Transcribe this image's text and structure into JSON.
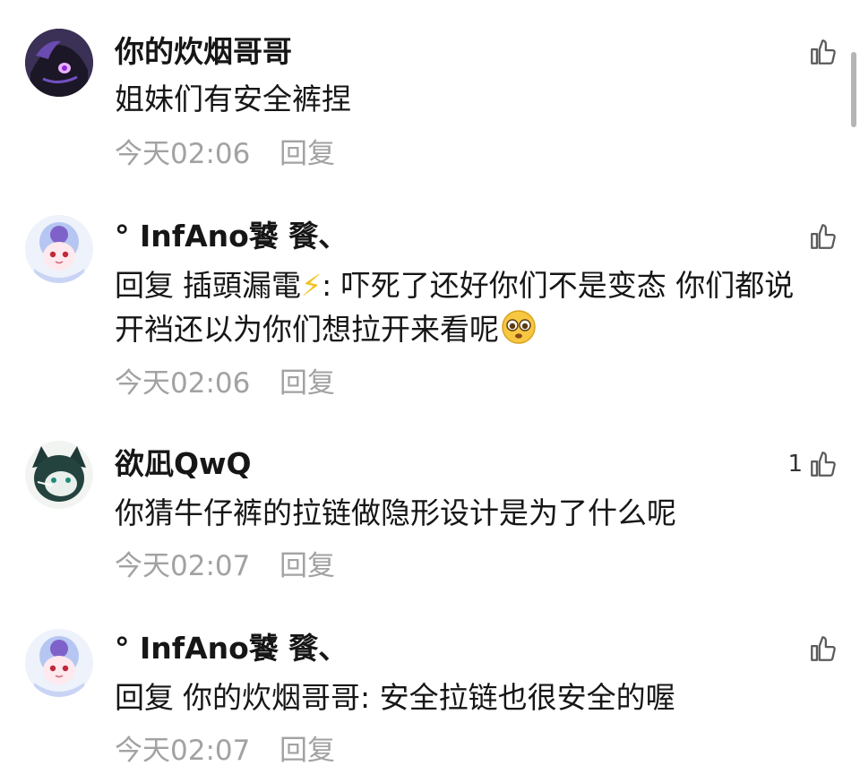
{
  "comments": [
    {
      "author": "你的炊烟哥哥",
      "text": "姐妹们有安全裤捏",
      "time": "今天02:06",
      "reply_label": "回复",
      "likes": ""
    },
    {
      "author": "° InfAno饕 餮、",
      "reply_prefix": "回复",
      "reply_to": "插頭漏電",
      "bolt": "⚡",
      "text": ": 吓死了还好你们不是变态 你们都说开裆还以为你们想拉开来看呢",
      "time": "今天02:06",
      "reply_label": "回复",
      "likes": ""
    },
    {
      "author": "欲凪QwQ",
      "text": "你猜牛仔裤的拉链做隐形设计是为了什么呢",
      "time": "今天02:07",
      "reply_label": "回复",
      "likes": "1"
    },
    {
      "author": "° InfAno饕 餮、",
      "reply_prefix": "回复",
      "reply_to": "你的炊烟哥哥",
      "text": ": 安全拉链也很安全的喔",
      "time": "今天02:07",
      "reply_label": "回复",
      "likes": ""
    }
  ],
  "icons": {
    "like": "thumbs-up-icon",
    "emoji": "pleading-face-icon"
  },
  "colors": {
    "text": "#161616",
    "meta": "#a2a2a2",
    "bolt": "#f2c21b"
  }
}
